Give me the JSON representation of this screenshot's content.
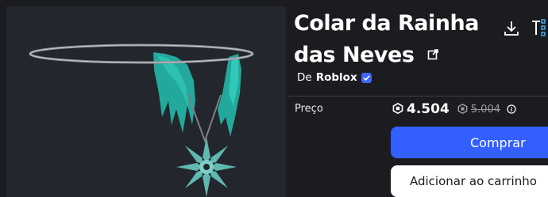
{
  "item": {
    "title": "Colar da Rainha das Neves",
    "creator_prefix": "De",
    "creator_name": "Roblox",
    "price_label": "Preço",
    "price": "4.504",
    "original_price": "5.004"
  },
  "actions": {
    "buy_label": "Comprar",
    "add_to_cart_label": "Adicionar ao carrinho"
  },
  "icons": {
    "external_link": "external-link-icon",
    "download": "download-icon",
    "verified": "verified-badge-icon",
    "robux": "robux-icon",
    "info": "info-icon",
    "try_on": "try-on-icon"
  },
  "colors": {
    "accent": "#335fff",
    "background": "#1b1c20",
    "preview_bg": "#23262d",
    "verified": "#3d66f5",
    "crystal": "#2bb3a8"
  }
}
